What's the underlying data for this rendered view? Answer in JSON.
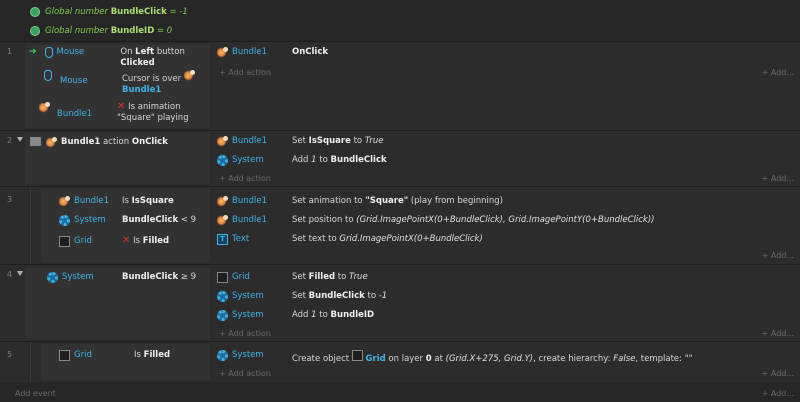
{
  "globals": [
    {
      "prefix": "Global number",
      "name": "BundleClick",
      "op": "=",
      "value": "-1"
    },
    {
      "prefix": "Global number",
      "name": "BundleID",
      "op": "=",
      "value": "0"
    }
  ],
  "add_action": "+ Add action",
  "add_right": "+ Add...",
  "add_event": "Add event",
  "ev1": {
    "num": "1",
    "c1_obj": "Mouse",
    "c1_pre": "On",
    "c1_b1": "Left",
    "c1_mid": "button",
    "c1_b2": "Clicked",
    "c2_obj": "Mouse",
    "c2_pre": "Cursor is over",
    "c2_b": "Bundle1",
    "c3_obj": "Bundle1",
    "c3_pre": "Is animation",
    "c3_post": "\"Square\" playing",
    "a1_obj": "Bundle1",
    "a1_txt": "OnClick"
  },
  "ev2": {
    "num": "2",
    "head_b": "Bundle1",
    "head_mid": "action",
    "head_b2": "OnClick",
    "a1_obj": "Bundle1",
    "a1_pre": "Set",
    "a1_b": "IsSquare",
    "a1_mid": "to",
    "a1_i": "True",
    "a2_obj": "System",
    "a2_pre": "Add",
    "a2_i": "1",
    "a2_mid": "to",
    "a2_b": "BundleClick"
  },
  "ev3": {
    "num": "3",
    "c1_obj": "Bundle1",
    "c1_pre": "Is",
    "c1_b": "IsSquare",
    "c2_obj": "System",
    "c2_b": "BundleClick",
    "c2_post": "< 9",
    "c3_obj": "Grid",
    "c3_pre": "Is",
    "c3_b": "Filled",
    "a1_obj": "Bundle1",
    "a1_pre": "Set animation to",
    "a1_b": "\"Square\"",
    "a1_post": "(play from beginning)",
    "a2_obj": "Bundle1",
    "a2_pre": "Set position to",
    "a2_i": "(Grid.ImagePointX(0+BundleClick), Grid.ImagePointY(0+BundleClick))",
    "a3_obj": "Text",
    "a3_pre": "Set text to",
    "a3_i": "Grid.ImagePointX(0+BundleClick)"
  },
  "ev4": {
    "num": "4",
    "c1_obj": "System",
    "c1_b": "BundleClick",
    "c1_post": "≥ 9",
    "a1_obj": "Grid",
    "a1_pre": "Set",
    "a1_b": "Filled",
    "a1_mid": "to",
    "a1_i": "True",
    "a2_obj": "System",
    "a2_pre": "Set",
    "a2_b": "BundleClick",
    "a2_mid": "to",
    "a2_i": "-1",
    "a3_obj": "System",
    "a3_pre": "Add",
    "a3_i": "1",
    "a3_mid": "to",
    "a3_b": "BundleID"
  },
  "ev5": {
    "num": "5",
    "c1_obj": "Grid",
    "c1_pre": "Is",
    "c1_b": "Filled",
    "a1_obj": "System",
    "a1_pre": "Create object",
    "a1_b": "Grid",
    "a1_mid": "on layer",
    "a1_b2": "0",
    "a1_mid2": "at",
    "a1_i": "(Grid.X+275, Grid.Y)",
    "a1_mid3": ", create hierarchy:",
    "a1_i2": "False",
    "a1_post": ", template: \"\""
  }
}
